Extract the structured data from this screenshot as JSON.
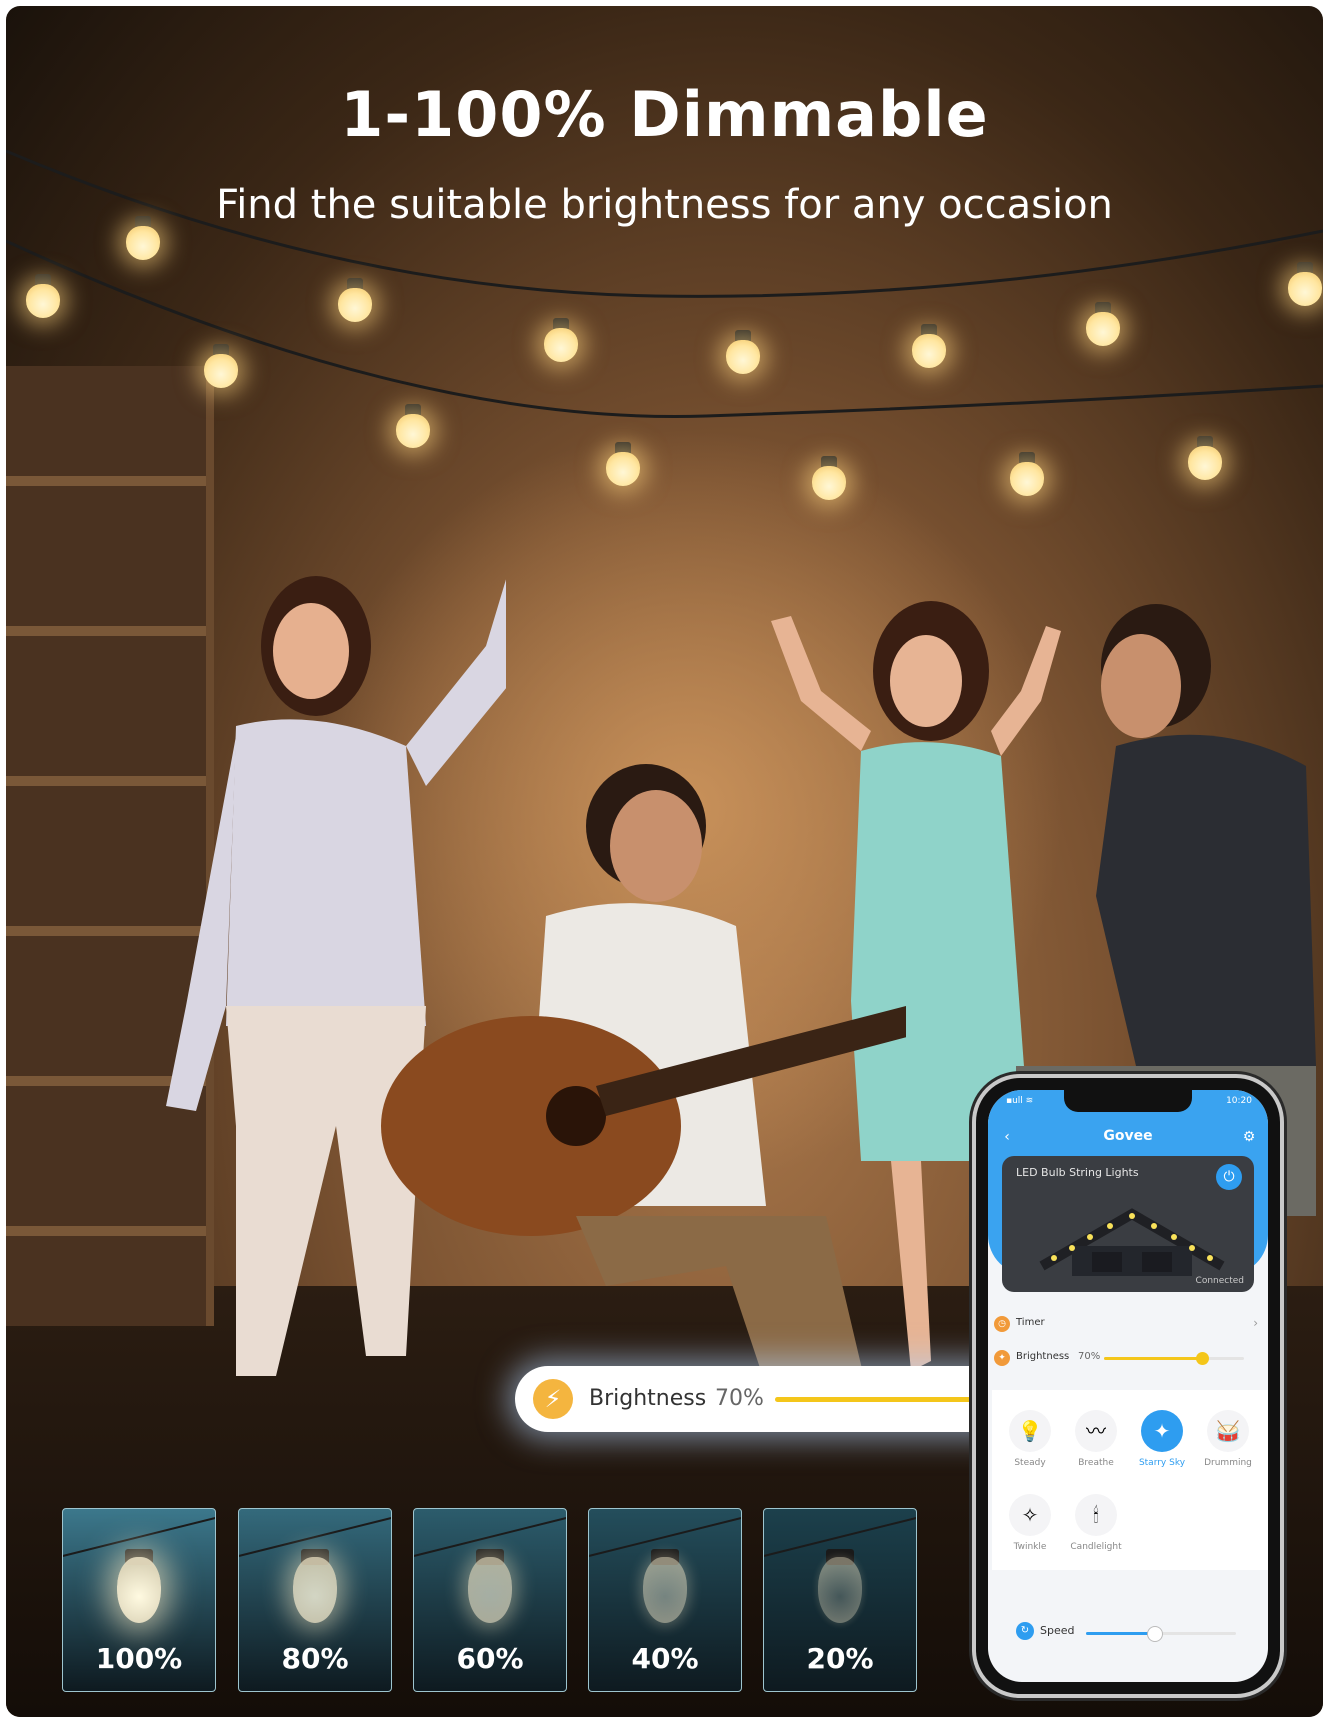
{
  "headline": {
    "title": "1-100% Dimmable",
    "subtitle": "Find the suitable brightness for any occasion"
  },
  "brightness_pill": {
    "icon": "bulb-icon",
    "label": "Brightness",
    "value": "70%",
    "level": 0.7
  },
  "thumbnails": [
    {
      "label": "100%",
      "level": 1.0
    },
    {
      "label": "80%",
      "level": 0.8
    },
    {
      "label": "60%",
      "level": 0.6
    },
    {
      "label": "40%",
      "level": 0.4
    },
    {
      "label": "20%",
      "level": 0.2
    }
  ],
  "phone": {
    "status_left": "▪︎ull ≋",
    "status_right": "10:20",
    "app_name": "Govee",
    "device_name": "LED Bulb String Lights",
    "connection": "Connected",
    "timer_label": "Timer",
    "brightness_label": "Brightness",
    "brightness_value": "70%",
    "brightness_level": 0.7,
    "modes": [
      {
        "label": "Steady",
        "icon": "steady-bulb-icon",
        "glyph": "💡",
        "selected": false
      },
      {
        "label": "Breathe",
        "icon": "breathe-icon",
        "glyph": "〰",
        "selected": false
      },
      {
        "label": "Starry Sky",
        "icon": "starry-sky-icon",
        "glyph": "✦",
        "selected": true
      },
      {
        "label": "Drumming",
        "icon": "drum-icon",
        "glyph": "🥁",
        "selected": false
      },
      {
        "label": "Twinkle",
        "icon": "twinkle-icon",
        "glyph": "✧",
        "selected": false
      },
      {
        "label": "Candlelight",
        "icon": "candle-icon",
        "glyph": "🕯",
        "selected": false
      }
    ],
    "speed_label": "Speed",
    "speed_level": 0.45
  },
  "colors": {
    "accent_blue": "#2e9df0",
    "brightness_yellow": "#f4c61a",
    "warm_bulb": "#ffe6a0"
  }
}
